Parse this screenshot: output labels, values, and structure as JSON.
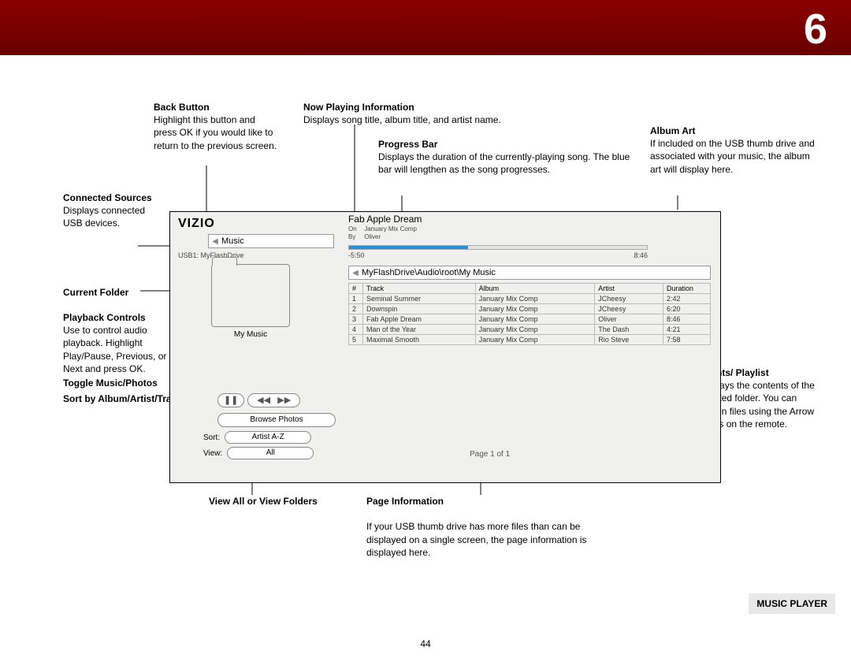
{
  "chapter_number": "6",
  "page_number": "44",
  "footer_tag": "MUSIC PLAYER",
  "annotations": {
    "back_button": {
      "h": "Back Button",
      "b": "Highlight this button and press OK if you would like to return to the previous screen."
    },
    "now_playing": {
      "h": "Now Playing Information",
      "b": "Displays song title, album title, and artist name."
    },
    "progress_bar": {
      "h": "Progress Bar",
      "b": "Displays the duration of the currently-playing song. The blue bar will lengthen as the song progresses."
    },
    "album_art": {
      "h": "Album Art",
      "b": "If included on the USB thumb drive and associated with your music, the album art will display here."
    },
    "connected": {
      "h": "Connected Sources",
      "b": "Displays connected USB devices."
    },
    "current_folder": {
      "h": "Current Folder"
    },
    "playback": {
      "h": "Playback Controls",
      "b": "Use to control audio playback. Highlight Play/Pause, Previous, or Next and press OK."
    },
    "toggle": {
      "h": "Toggle Music/Photos"
    },
    "sort": {
      "h": "Sort by Album/Artist/Track"
    },
    "view_all": {
      "h": "View All or View Folders"
    },
    "page_info": {
      "h": "Page Information",
      "b": "If your USB thumb drive has more files than can be displayed on a single screen, the page information is displayed here."
    },
    "folder_contents": {
      "h": "Folder Contents/ Playlist",
      "b": "This area displays the contents of the currently selected folder. You can browse between files using the Arrow and OK buttons on the remote."
    }
  },
  "window": {
    "logo": "VIZIO",
    "back_label": "Music",
    "usb_label": "USB1: MyFlashDrive",
    "folder_label": "My Music",
    "browse_label": "Browse Photos",
    "sort_key": "Sort:",
    "sort_val": "Artist A-Z",
    "view_key": "View:",
    "view_val": "All",
    "np_title": "Fab Apple Dream",
    "np_on_k": "On",
    "np_on_v": "January Mix Comp",
    "np_by_k": "By",
    "np_by_v": "Oliver",
    "elapsed": "-5:50",
    "total": "8:46",
    "crumb": "MyFlashDrive\\Audio\\root\\My Music",
    "page_info": "Page 1 of 1",
    "table": {
      "headers": [
        "#",
        "Track",
        "Album",
        "Artist",
        "Duration"
      ],
      "rows": [
        [
          "1",
          "Seminal Summer",
          "January Mix Comp",
          "JCheesy",
          "2:42"
        ],
        [
          "2",
          "Downspin",
          "January Mix Comp",
          "JCheesy",
          "6:20"
        ],
        [
          "3",
          "Fab Apple Dream",
          "January Mix Comp",
          "Oliver",
          "8:46"
        ],
        [
          "4",
          "Man of the Year",
          "January Mix Comp",
          "The Dash",
          "4:21"
        ],
        [
          "5",
          "Maximal Smooth",
          "January Mix Comp",
          "Rio Steve",
          "7:58"
        ]
      ]
    }
  }
}
